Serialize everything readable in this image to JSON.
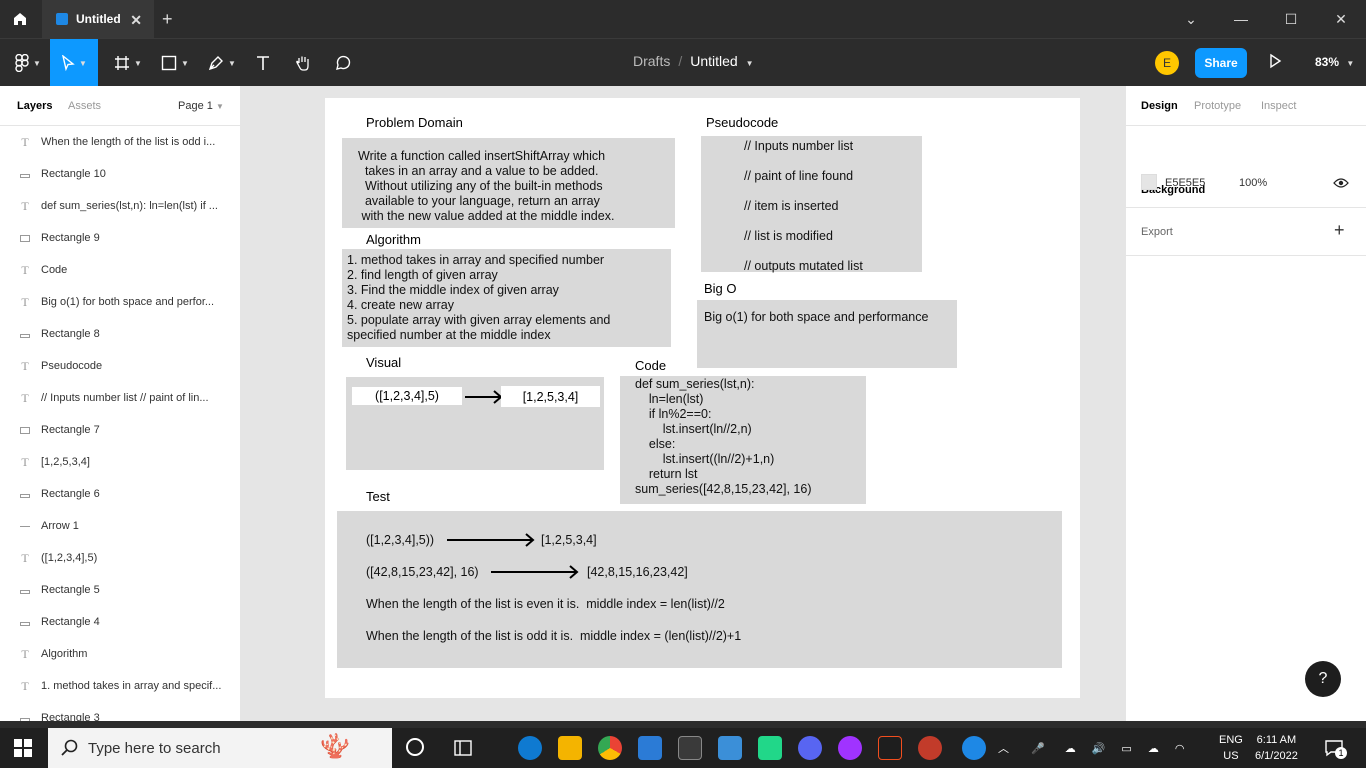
{
  "app": {
    "tab_title": "Untitled",
    "breadcrumb_project": "Drafts",
    "breadcrumb_sep": "/",
    "breadcrumb_file": "Untitled",
    "avatar_initial": "E",
    "share_label": "Share",
    "zoom": "83%"
  },
  "left_panel": {
    "tabs": [
      "Layers",
      "Assets"
    ],
    "page": "Page 1",
    "layers": [
      {
        "type": "text",
        "name": "When the length of the list is odd i..."
      },
      {
        "type": "rect-flat",
        "name": "Rectangle 10"
      },
      {
        "type": "text",
        "name": "def sum_series(lst,n): ln=len(lst) if ..."
      },
      {
        "type": "rect",
        "name": "Rectangle 9"
      },
      {
        "type": "text",
        "name": "Code"
      },
      {
        "type": "text",
        "name": "Big o(1) for both space and perfor..."
      },
      {
        "type": "rect-flat",
        "name": "Rectangle 8"
      },
      {
        "type": "text",
        "name": "Pseudocode"
      },
      {
        "type": "text",
        "name": "// Inputs number list // paint of lin..."
      },
      {
        "type": "rect",
        "name": "Rectangle 7"
      },
      {
        "type": "text",
        "name": "[1,2,5,3,4]"
      },
      {
        "type": "rect-flat",
        "name": "Rectangle 6"
      },
      {
        "type": "line",
        "name": "Arrow 1"
      },
      {
        "type": "text",
        "name": "([1,2,3,4],5)"
      },
      {
        "type": "rect-flat",
        "name": "Rectangle 5"
      },
      {
        "type": "rect-flat",
        "name": "Rectangle 4"
      },
      {
        "type": "text",
        "name": "Algorithm"
      },
      {
        "type": "text",
        "name": "1. method takes in array and specif..."
      },
      {
        "type": "rect-flat",
        "name": "Rectangle 3"
      }
    ]
  },
  "canvas": {
    "problem_domain_title": "Problem Domain",
    "problem_domain_text": "Write a function called insertShiftArray which\n  takes in an array and a value to be added.\n  Without utilizing any of the built-in methods\n  available to your language, return an array\n with the new value added at the middle index.",
    "algorithm_title": "Algorithm",
    "algorithm_text": "1. method takes in array and specified number\n2. find length of given array\n3. Find the middle index of given array\n4. create new array\n5. populate array with given array elements and\nspecified number at the middle index",
    "pseudocode_title": "Pseudocode",
    "pseudocode_lines": [
      "// Inputs number list",
      "// paint of line found",
      "// item is inserted",
      "// list is modified",
      "// outputs mutated list"
    ],
    "bigo_title": "Big O",
    "bigo_text": "Big o(1) for both space and performance",
    "visual_title": "Visual",
    "visual_input": "([1,2,3,4],5)",
    "visual_output": "[1,2,5,3,4]",
    "code_title": "Code",
    "code_text": "def sum_series(lst,n):\n    ln=len(lst)\n    if ln%2==0:\n        lst.insert(ln//2,n)\n    else:\n        lst.insert((ln//2)+1,n)\n    return lst\nsum_series([42,8,15,23,42], 16)",
    "test_title": "Test",
    "test_row1_in": "([1,2,3,4],5))",
    "test_row1_out": "[1,2,5,3,4]",
    "test_row2_in": "([42,8,15,23,42], 16)",
    "test_row2_out": "[42,8,15,16,23,42]",
    "test_even": "When the length of the list is even it is.  middle index = len(list)//2",
    "test_odd": "When the length of the list is odd it is.  middle index = (len(list)//2)+1"
  },
  "right_panel": {
    "tabs": [
      "Design",
      "Prototype",
      "Inspect"
    ],
    "background_label": "Background",
    "background_hex": "E5E5E5",
    "background_opacity": "100%",
    "export_label": "Export",
    "background_color": "#E5E5E5"
  },
  "taskbar": {
    "search_placeholder": "Type here to search",
    "lang_top": "ENG",
    "lang_bottom": "US",
    "time": "6:11 AM",
    "date": "6/1/2022",
    "notification_count": "1"
  },
  "colors": {
    "accent": "#0d99ff",
    "chrome": "#2c2c2c",
    "box_fill": "#d9d9d9"
  }
}
